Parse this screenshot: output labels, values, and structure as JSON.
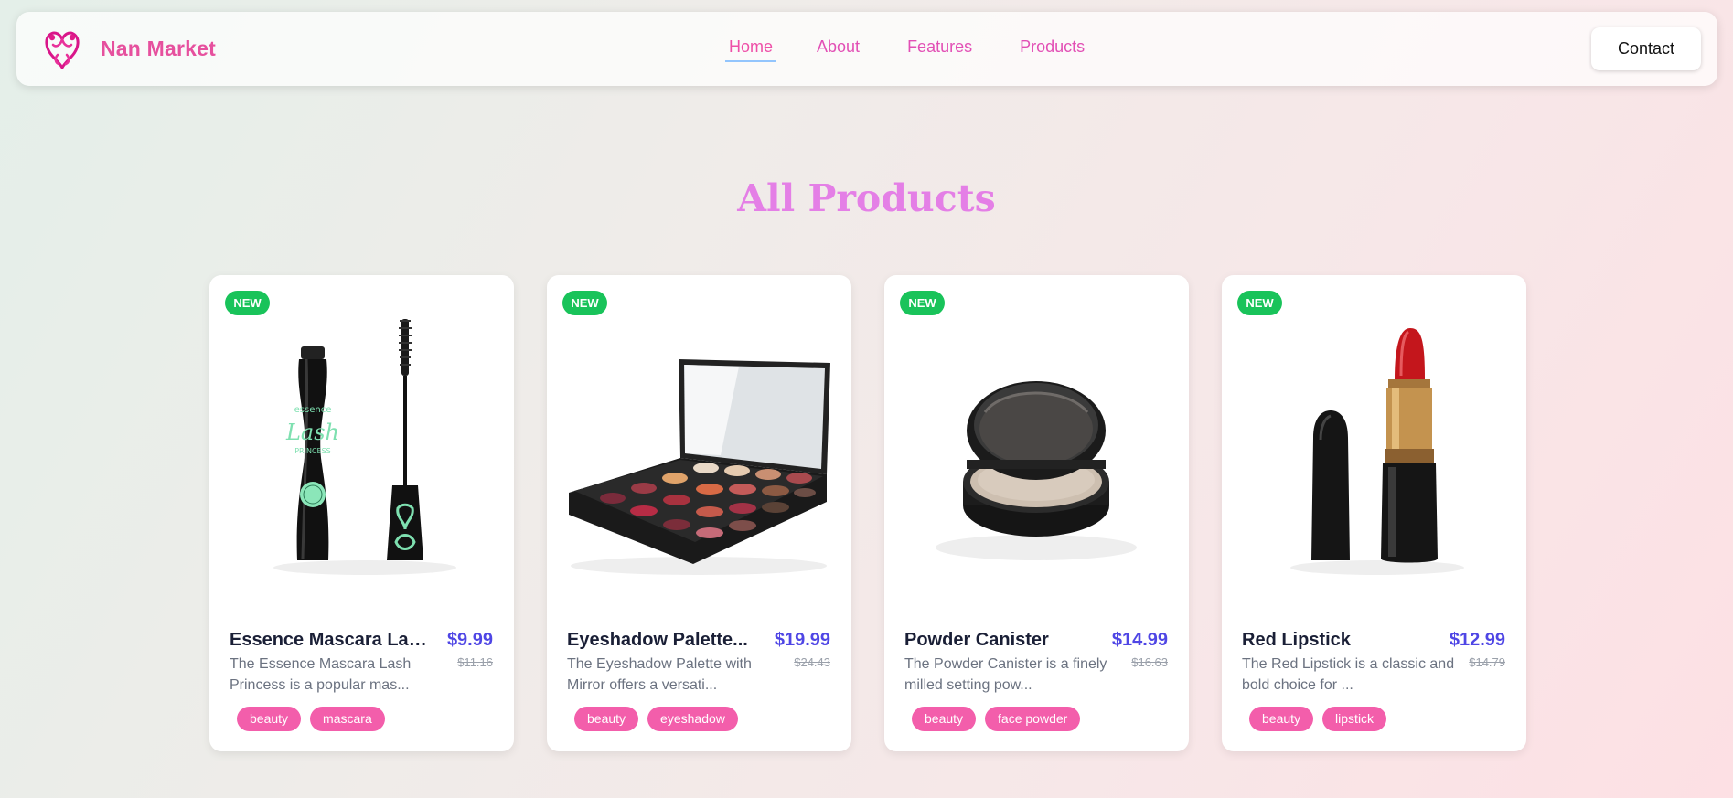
{
  "brand": {
    "name": "Nan Market",
    "logo_icon": "heart-swirl-icon"
  },
  "nav": {
    "links": [
      {
        "label": "Home",
        "active": true
      },
      {
        "label": "About"
      },
      {
        "label": "Features"
      },
      {
        "label": "Products"
      }
    ],
    "contact_label": "Contact"
  },
  "section": {
    "title": "All Products"
  },
  "colors": {
    "brand": "#e6509e",
    "heading": "#e47fe6",
    "price": "#4f46e5",
    "badge": "#19c35a",
    "tag": "#f35eab"
  },
  "products": [
    {
      "badge": "NEW",
      "image_icon": "mascara-icon",
      "name": "Essence Mascara Lash...",
      "price": "$9.99",
      "old_price": "$11.16",
      "description": "The Essence Mascara Lash Princess is a popular mas...",
      "tags": [
        "beauty",
        "mascara"
      ]
    },
    {
      "badge": "NEW",
      "image_icon": "eyeshadow-palette-icon",
      "name": "Eyeshadow Palette...",
      "price": "$19.99",
      "old_price": "$24.43",
      "description": "The Eyeshadow Palette with Mirror offers a versati...",
      "tags": [
        "beauty",
        "eyeshadow"
      ]
    },
    {
      "badge": "NEW",
      "image_icon": "powder-compact-icon",
      "name": "Powder Canister",
      "price": "$14.99",
      "old_price": "$16.63",
      "description": "The Powder Canister is a finely milled setting pow...",
      "tags": [
        "beauty",
        "face powder"
      ]
    },
    {
      "badge": "NEW",
      "image_icon": "lipstick-icon",
      "name": "Red Lipstick",
      "price": "$12.99",
      "old_price": "$14.79",
      "description": "The Red Lipstick is a classic and bold choice for ...",
      "tags": [
        "beauty",
        "lipstick"
      ]
    }
  ]
}
